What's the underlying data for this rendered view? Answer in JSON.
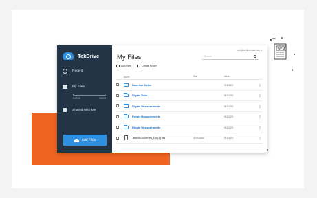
{
  "app": {
    "name": "TekDrive",
    "user_email": "nick@tekdrivedata.com",
    "storage_used": "1.57GB",
    "storage_total": "300GB",
    "storage_fraction": 0.005
  },
  "sidebar": {
    "items": [
      {
        "label": "Recent",
        "icon": "clock-icon"
      },
      {
        "label": "My Files",
        "icon": "folder-icon"
      },
      {
        "label": "Shared With Me",
        "icon": "shared-folder-icon"
      }
    ],
    "add_files_label": "Add Files"
  },
  "main": {
    "title": "My Files",
    "search_placeholder": "Search",
    "actions": {
      "add_files": "Add Files",
      "create_folder": "Create Folder"
    },
    "columns": {
      "name": "Name",
      "size": "Size",
      "added": "Added"
    },
    "rows": [
      {
        "type": "folder",
        "name": "Baseline Noise",
        "size": "",
        "added": "9/10/20",
        "more": "⋮"
      },
      {
        "type": "folder",
        "name": "Digital Data",
        "size": "",
        "added": "9/10/20",
        "more": "⋮"
      },
      {
        "type": "folder",
        "name": "Digital Measurements",
        "size": "",
        "added": "9/10/20",
        "more": "⋮"
      },
      {
        "type": "folder",
        "name": "Power Measurements",
        "size": "",
        "added": "9/10/20",
        "more": "⋮"
      },
      {
        "type": "folder",
        "name": "Ripple Measurements",
        "size": "",
        "added": "9/10/20",
        "more": "⋮"
      },
      {
        "type": "file",
        "name": "TekMSO5Series_Dc (1).tss",
        "size": "3593368",
        "added": "9/10/20",
        "more": "⋮"
      }
    ]
  },
  "wfm_badge": {
    "label": "WFM"
  },
  "colors": {
    "accent": "#2f8fe0",
    "sidebar": "#233447",
    "orange": "#f06421"
  }
}
